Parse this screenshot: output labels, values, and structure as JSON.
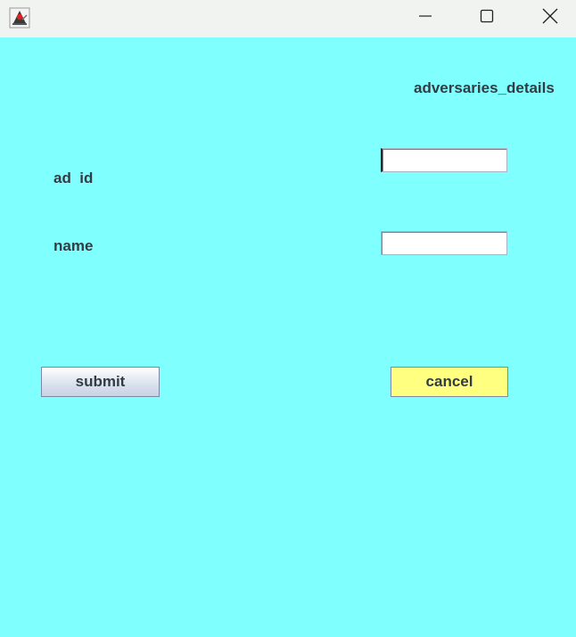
{
  "window": {
    "controls": {
      "minimize_icon": "minimize-icon",
      "maximize_icon": "maximize-icon",
      "close_icon": "close-icon"
    },
    "app_icon": "java-duke-icon"
  },
  "form": {
    "heading": "adversaries_details",
    "fields": {
      "ad_id_label": "ad  id",
      "ad_id_value": "",
      "name_label": "name",
      "name_value": ""
    },
    "buttons": {
      "submit_label": "submit",
      "cancel_label": "cancel"
    }
  },
  "colors": {
    "background": "#80ffff",
    "cancel_button": "#ffff80",
    "titlebar": "#f1f3f0",
    "text": "#333c44"
  }
}
